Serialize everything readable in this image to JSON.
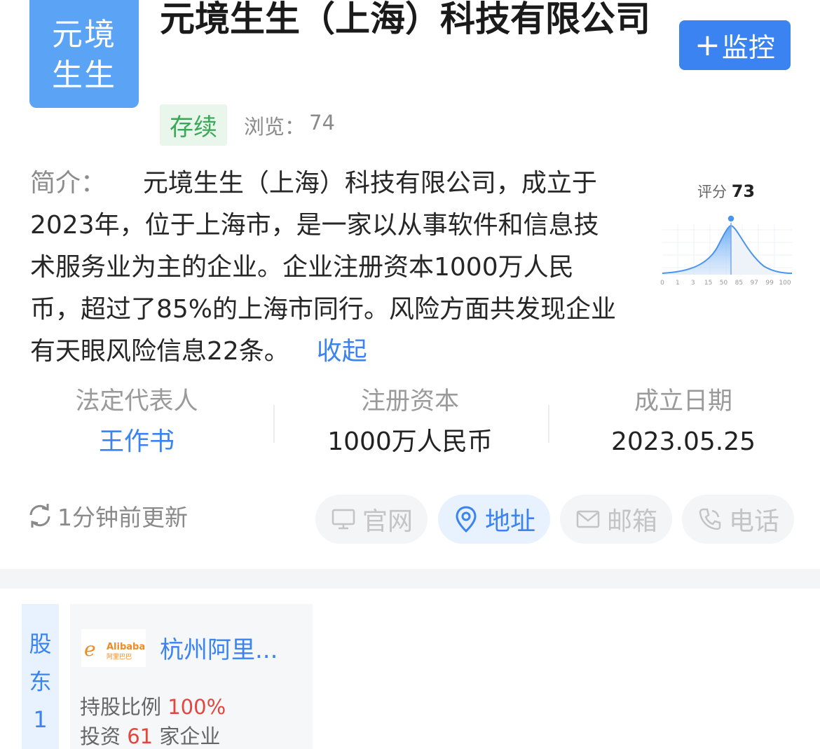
{
  "company": {
    "logo_line1": "元境",
    "logo_line2": "生生",
    "name": "元境生生（上海）科技有限公司",
    "status": "存续",
    "views_label": "浏览：",
    "views_count": "74"
  },
  "monitor_button": {
    "plus": "+",
    "label": "监控"
  },
  "intro": {
    "label": "简介：",
    "text": "元境生生（上海）科技有限公司，成立于2023年，位于上海市，是一家以从事软件和信息技术服务业为主的企业。企业注册资本1000万人民币，超过了85%的上海市同行。风险方面共发现企业有天眼风险信息22条。",
    "collapse": "收起"
  },
  "score": {
    "label": "评分",
    "value": "73",
    "ticks": [
      "0",
      "1",
      "3",
      "15",
      "50",
      "85",
      "97",
      "99",
      "100"
    ]
  },
  "stats": [
    {
      "label": "法定代表人",
      "value": "王作书"
    },
    {
      "label": "注册资本",
      "value": "1000万人民币"
    },
    {
      "label": "成立日期",
      "value": "2023.05.25"
    }
  ],
  "update_text": "1分钟前更新",
  "actions": [
    {
      "label": "官网",
      "icon": "monitor-icon"
    },
    {
      "label": "地址",
      "icon": "location-pin-icon"
    },
    {
      "label": "邮箱",
      "icon": "mail-icon"
    },
    {
      "label": "电话",
      "icon": "phone-icon"
    }
  ],
  "shareholder": {
    "tag": [
      "股",
      "东",
      "1"
    ],
    "logo_en": "Alibaba",
    "logo_cn": "阿里巴巴",
    "name": "杭州阿里...",
    "share_label": "持股比例",
    "share_value": "100%",
    "invest_label": "投资",
    "invest_count": "61",
    "invest_suffix": "家企业"
  },
  "colors": {
    "brand_blue": "#3a83f1",
    "logo_bg": "#5aa3f5",
    "status_green": "#3aa857",
    "highlight_red": "#e3463c"
  }
}
